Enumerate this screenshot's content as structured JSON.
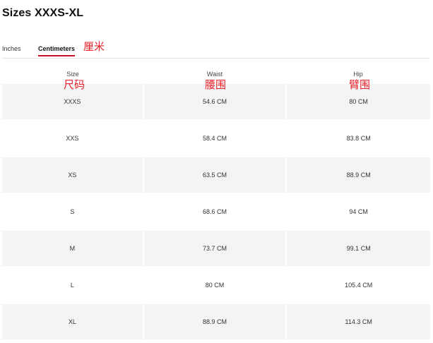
{
  "title": "Sizes XXXS-XL",
  "tabs": [
    {
      "label": "Inches",
      "active": false
    },
    {
      "label": "Centimeters",
      "active": true
    }
  ],
  "annotations": {
    "centimeters": "厘米",
    "size": "尺码",
    "waist": "腰围",
    "hip": "臂围",
    "color": "#e8202a"
  },
  "table": {
    "headers": [
      "Size",
      "Waist",
      "Hip"
    ],
    "rows": [
      [
        "XXXS",
        "54.6 CM",
        "80 CM"
      ],
      [
        "XXS",
        "58.4 CM",
        "83.8 CM"
      ],
      [
        "XS",
        "63.5 CM",
        "88.9 CM"
      ],
      [
        "S",
        "68.6 CM",
        "94 CM"
      ],
      [
        "M",
        "73.7 CM",
        "99.1 CM"
      ],
      [
        "L",
        "80 CM",
        "105.4 CM"
      ],
      [
        "XL",
        "88.9 CM",
        "114.3 CM"
      ]
    ]
  },
  "colors": {
    "active_tab_underline": "#c8102e",
    "shaded_row": "#f4f4f4"
  }
}
